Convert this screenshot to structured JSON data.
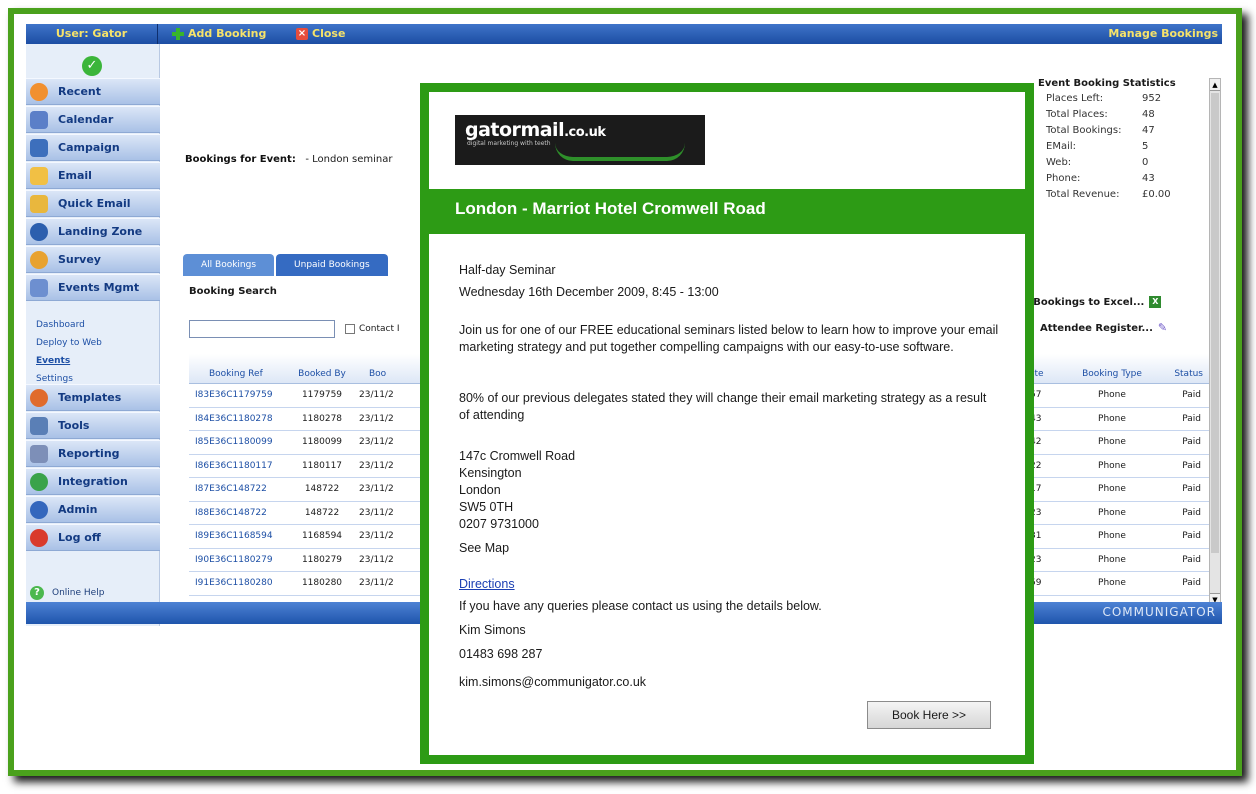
{
  "topbar": {
    "user": "User: Gator",
    "add_booking": "Add Booking",
    "close": "Close",
    "manage_bookings": "Manage Bookings"
  },
  "sidebar": {
    "items": [
      {
        "label": "Recent",
        "icon": "recent-icon"
      },
      {
        "label": "Calendar",
        "icon": "calendar-icon"
      },
      {
        "label": "Campaign",
        "icon": "campaign-icon"
      },
      {
        "label": "Email",
        "icon": "email-icon"
      },
      {
        "label": "Quick Email",
        "icon": "quick-email-icon"
      },
      {
        "label": "Landing Zone",
        "icon": "landing-zone-icon"
      },
      {
        "label": "Survey",
        "icon": "survey-icon"
      },
      {
        "label": "Events Mgmt",
        "icon": "events-icon"
      }
    ],
    "subitems": [
      "Dashboard",
      "Deploy to Web",
      "Events",
      "Settings"
    ],
    "items2": [
      {
        "label": "Templates",
        "icon": "templates-icon"
      },
      {
        "label": "Tools",
        "icon": "tools-icon"
      },
      {
        "label": "Reporting",
        "icon": "reporting-icon"
      },
      {
        "label": "Integration",
        "icon": "integration-icon"
      },
      {
        "label": "Admin",
        "icon": "admin-icon"
      },
      {
        "label": "Log off",
        "icon": "logoff-icon"
      }
    ],
    "help": "Online Help"
  },
  "main": {
    "bookings_for_label": "Bookings for Event:",
    "bookings_for_value": "- London seminar",
    "tabs": [
      "All Bookings",
      "Unpaid Bookings"
    ],
    "booking_search": "Booking Search",
    "contact_label": "Contact I",
    "table_headers": [
      "Booking Ref",
      "Booked By",
      "Boo"
    ],
    "rows": [
      {
        "ref": "I83E36C1179759",
        "by": "1179759",
        "date": "23/11/2"
      },
      {
        "ref": "I84E36C1180278",
        "by": "1180278",
        "date": "23/11/2"
      },
      {
        "ref": "I85E36C1180099",
        "by": "1180099",
        "date": "23/11/2"
      },
      {
        "ref": "I86E36C1180117",
        "by": "1180117",
        "date": "23/11/2"
      },
      {
        "ref": "I87E36C148722",
        "by": "148722",
        "date": "23/11/2"
      },
      {
        "ref": "I88E36C148722",
        "by": "148722",
        "date": "23/11/2"
      },
      {
        "ref": "I89E36C1168594",
        "by": "1168594",
        "date": "23/11/2"
      },
      {
        "ref": "I90E36C1180279",
        "by": "1180279",
        "date": "23/11/2"
      },
      {
        "ref": "I91E36C1180280",
        "by": "1180280",
        "date": "23/11/2"
      }
    ],
    "right_headers": [
      "ate",
      "Booking Type",
      "Status"
    ],
    "right_rows": [
      {
        "t": ":57",
        "type": "Phone",
        "status": "Paid"
      },
      {
        "t": ":43",
        "type": "Phone",
        "status": "Paid"
      },
      {
        "t": ":42",
        "type": "Phone",
        "status": "Paid"
      },
      {
        "t": ":22",
        "type": "Phone",
        "status": "Paid"
      },
      {
        "t": ":17",
        "type": "Phone",
        "status": "Paid"
      },
      {
        "t": ":23",
        "type": "Phone",
        "status": "Paid"
      },
      {
        "t": ":31",
        "type": "Phone",
        "status": "Paid"
      },
      {
        "t": ":23",
        "type": "Phone",
        "status": "Paid"
      },
      {
        "t": ":59",
        "type": "Phone",
        "status": "Paid"
      }
    ],
    "stats_title": "Event Booking Statistics",
    "stats": [
      {
        "k": "Places Left:",
        "v": "952"
      },
      {
        "k": "Total Places:",
        "v": "48"
      },
      {
        "k": "Total Bookings:",
        "v": "47"
      },
      {
        "k": "EMail:",
        "v": "5"
      },
      {
        "k": "Web:",
        "v": "0"
      },
      {
        "k": "Phone:",
        "v": "43"
      },
      {
        "k": "Total Revenue:",
        "v": "£0.00"
      }
    ],
    "export_excel": "t Bookings to Excel...",
    "attendee_register": "Attendee Register..."
  },
  "footer": {
    "brand": "COMMUNIGATOR"
  },
  "popup": {
    "logo_name_a": "gator",
    "logo_name_b": "mail",
    "logo_name_c": ".co.uk",
    "logo_tag": "digital marketing with teeth",
    "venue": "London - Marriot Hotel Cromwell Road",
    "type": "Half-day Seminar",
    "datetime": "Wednesday 16th December 2009, 8:45 - 13:00",
    "intro": "Join us for one of our FREE educational seminars listed below to learn how to improve your email marketing strategy and put together compelling campaigns with our easy-to-use software.",
    "stat": "80% of our previous delegates stated they will change their email marketing strategy as a result of attending",
    "address": [
      "147c Cromwell Road",
      "Kensington",
      "London",
      "SW5 0TH",
      "0207 9731000"
    ],
    "see_map": "See Map",
    "directions": "Directions",
    "queries": "If you have any queries please contact us using the details below.",
    "contact_name": "Kim Simons",
    "contact_phone": "01483 698 287",
    "contact_email": "kim.simons@communigator.co.uk",
    "book_button": "Book Here >>"
  },
  "colors": {
    "accent_green": "#2d9b15",
    "nav_blue": "#1c4da3",
    "topbar_text": "#f6e36a"
  }
}
